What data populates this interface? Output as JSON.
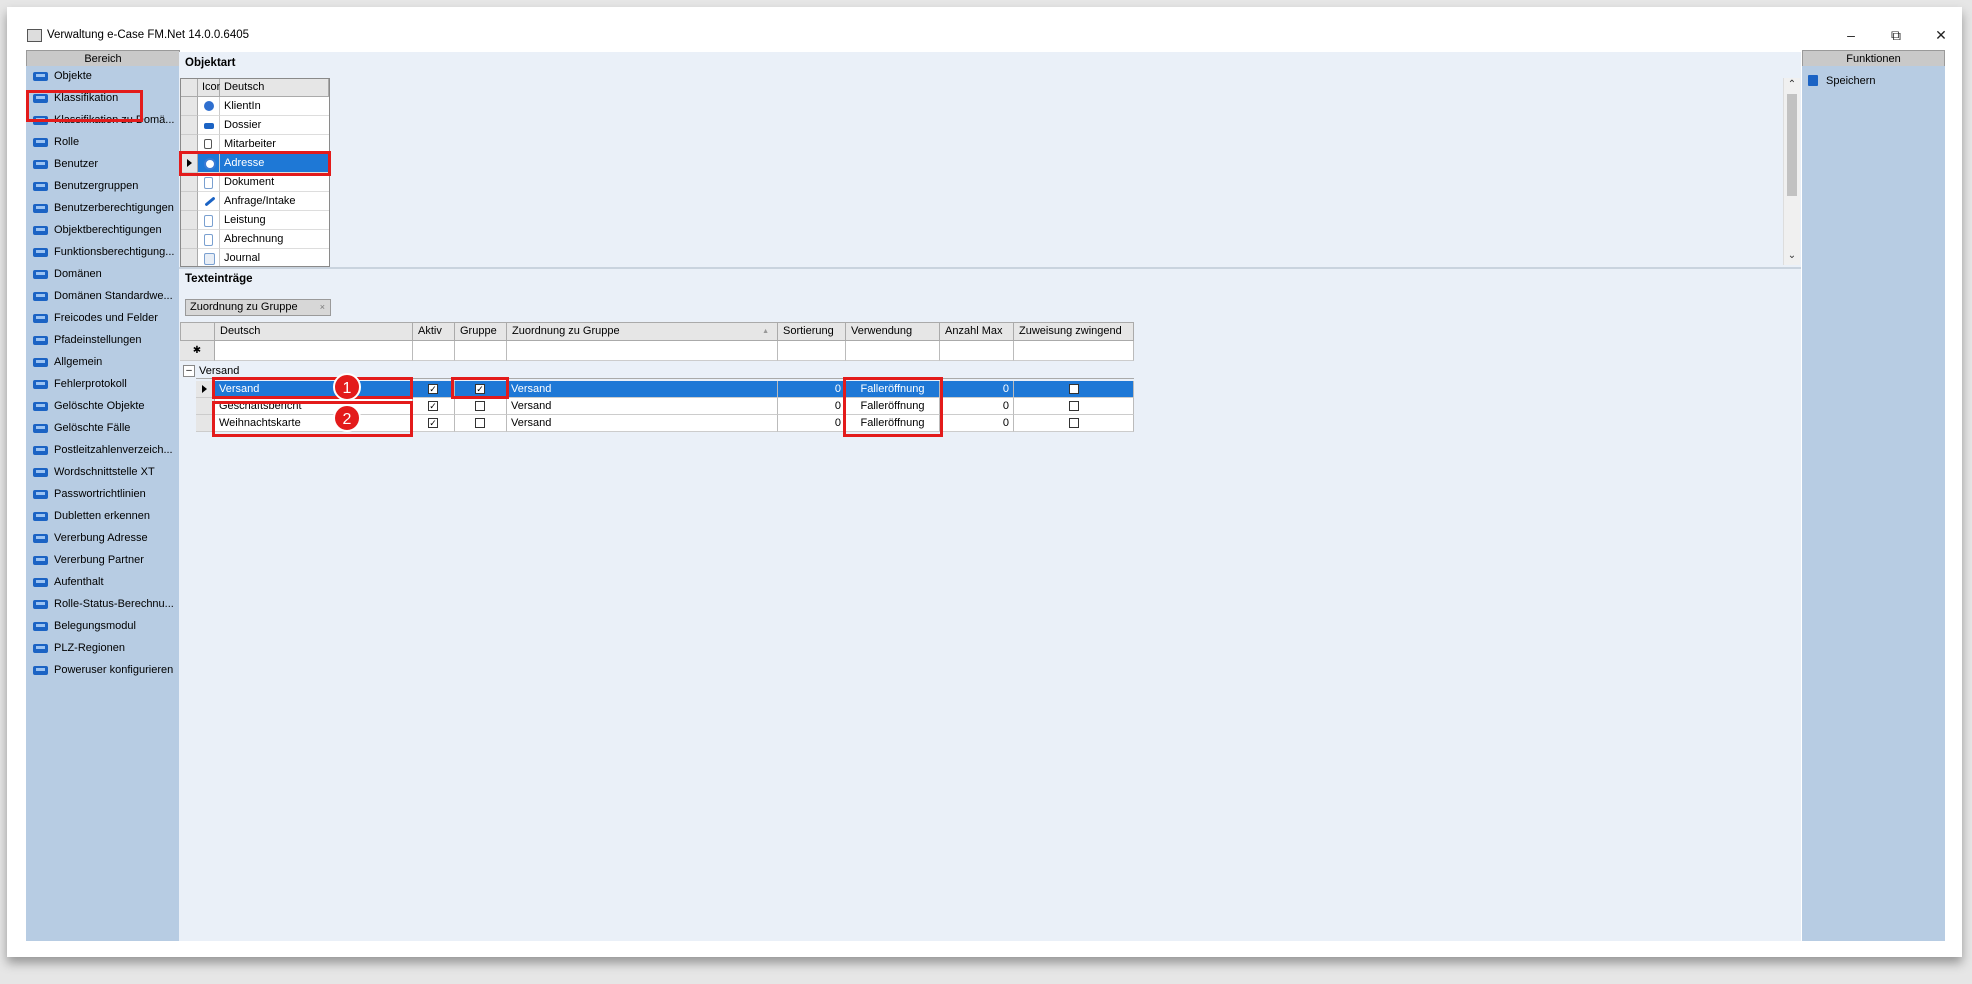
{
  "window": {
    "title": "Verwaltung e-Case FM.Net 14.0.0.6405",
    "minimize": "–",
    "restore": "⧉",
    "close": "✕"
  },
  "left_panel": {
    "header": "Bereich",
    "items": [
      "Objekte",
      "Klassifikation",
      "Klassifikation zu Domä...",
      "Rolle",
      "Benutzer",
      "Benutzergruppen",
      "Benutzerberechtigungen",
      "Objektberechtigungen",
      "Funktionsberechtigung...",
      "Domänen",
      "Domänen Standardwe...",
      "Freicodes und Felder",
      "Pfadeinstellungen",
      "Allgemein",
      "Fehlerprotokoll",
      "Gelöschte Objekte",
      "Gelöschte Fälle",
      "Postleitzahlenverzeich...",
      "Wordschnittstelle XT",
      "Passwortrichtlinien",
      "Dubletten erkennen",
      "Vererbung Adresse",
      "Vererbung Partner",
      "Aufenthalt",
      "Rolle-Status-Berechnu...",
      "Belegungsmodul",
      "PLZ-Regionen",
      "Poweruser konfigurieren"
    ]
  },
  "right_panel": {
    "header": "Funktionen",
    "save_label": "Speichern"
  },
  "objektart": {
    "title": "Objektart",
    "columns": [
      "Icon",
      "Deutsch"
    ],
    "rows": [
      "KlientIn",
      "Dossier",
      "Mitarbeiter",
      "Adresse",
      "Dokument",
      "Anfrage/Intake",
      "Leistung",
      "Abrechnung",
      "Journal"
    ],
    "selected": "Adresse"
  },
  "texteintraege": {
    "title": "Texteinträge",
    "group_box": "Zuordnung zu Gruppe",
    "group_box_x": "×",
    "new_row_marker": "✱",
    "columns": [
      "Deutsch",
      "Aktiv",
      "Gruppe",
      "Zuordnung zu Gruppe",
      "Sortierung",
      "Verwendung",
      "Anzahl Max",
      "Zuweisung zwingend"
    ],
    "sort_glyph": "▲",
    "group": {
      "toggle": "–",
      "label": "Versand"
    },
    "rows": [
      {
        "deutsch": "Versand",
        "aktiv": "✓",
        "gruppe": "✓",
        "zuordnung": "Versand",
        "sortierung": "0",
        "verwendung": "Falleröffnung",
        "anzahl_max": "0",
        "zwingend": ""
      },
      {
        "deutsch": "Geschäftsbericht",
        "aktiv": "✓",
        "gruppe": "",
        "zuordnung": "Versand",
        "sortierung": "0",
        "verwendung": "Falleröffnung",
        "anzahl_max": "0",
        "zwingend": ""
      },
      {
        "deutsch": "Weihnachtskarte",
        "aktiv": "✓",
        "gruppe": "",
        "zuordnung": "Versand",
        "sortierung": "0",
        "verwendung": "Falleröffnung",
        "anzahl_max": "0",
        "zwingend": ""
      }
    ]
  },
  "annotations": {
    "marker1": "1",
    "marker2": "2"
  },
  "colors": {
    "panel_blue": "#b7cce3",
    "selection_blue": "#1e78d6",
    "highlight_red": "#e31b1b"
  }
}
